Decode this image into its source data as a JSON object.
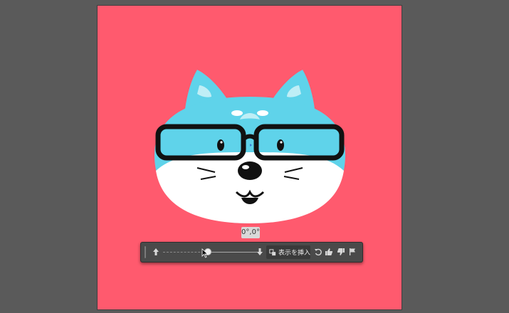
{
  "canvas": {
    "background_color": "#5a5a5a",
    "artboard_color": "#ff5a6e",
    "character_colors": {
      "fur": "#5fd3ea",
      "face": "#ffffff",
      "ear_inner": "#bfeef6",
      "outline": "#111111"
    }
  },
  "rotation_tooltip": {
    "value": "0°,0°"
  },
  "contextual_taskbar": {
    "icons": [
      "grip-handle-icon",
      "arrow-up-icon",
      "arrow-down-icon",
      "insert-view-icon",
      "undo-icon",
      "thumbs-up-icon",
      "thumbs-down-icon",
      "flag-icon"
    ],
    "insert_button_label": "表示を挿入",
    "slider_level": 0.45
  }
}
